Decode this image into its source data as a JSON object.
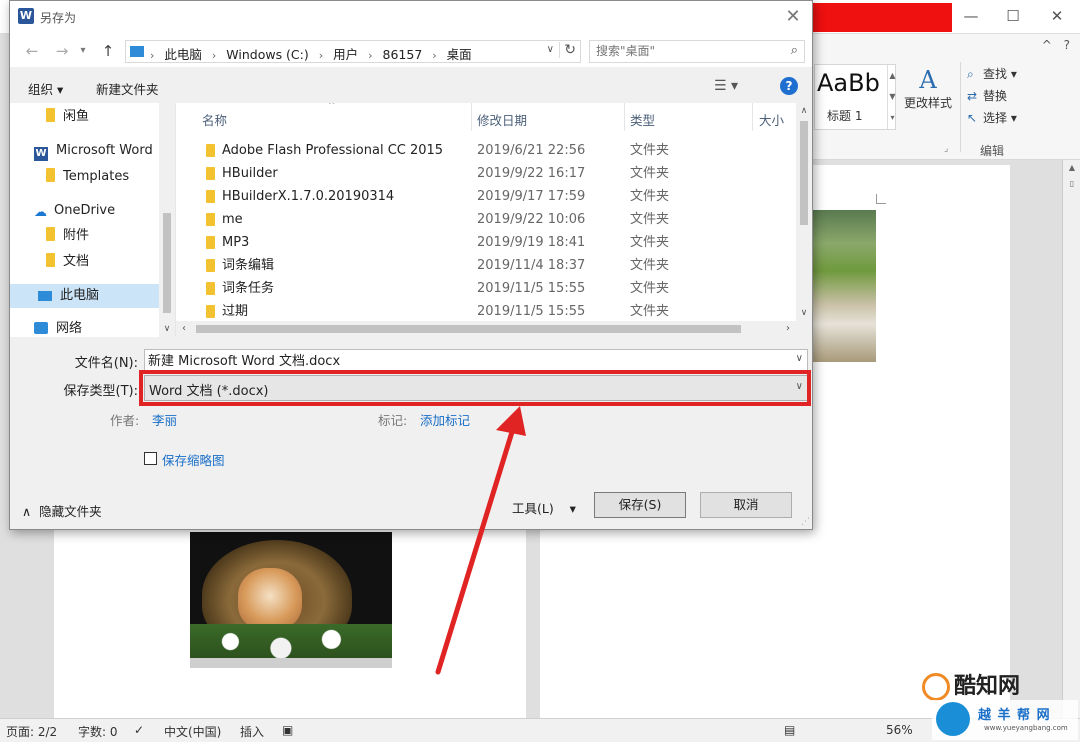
{
  "dialog": {
    "title": "另存为",
    "address": [
      "此电脑",
      "Windows (C:)",
      "用户",
      "86157",
      "桌面"
    ],
    "search_placeholder": "搜索\"桌面\"",
    "toolbar": {
      "organize": "组织 ▾",
      "new_folder": "新建文件夹"
    },
    "nav_items": [
      {
        "label": "闲鱼",
        "icon": "folder-icon"
      },
      {
        "label": "Microsoft Word",
        "icon": "word-icon"
      },
      {
        "label": "Templates",
        "icon": "folder-icon"
      },
      {
        "label": "OneDrive",
        "icon": "cloud-icon"
      },
      {
        "label": "附件",
        "icon": "folder-icon"
      },
      {
        "label": "文档",
        "icon": "folder-icon"
      },
      {
        "label": "此电脑",
        "icon": "pc-icon",
        "selected": true
      },
      {
        "label": "网络",
        "icon": "network-icon"
      }
    ],
    "columns": [
      "名称",
      "修改日期",
      "类型",
      "大小"
    ],
    "files": [
      {
        "name": "Adobe Flash Professional CC 2015",
        "date": "2019/6/21 22:56",
        "type": "文件夹"
      },
      {
        "name": "HBuilder",
        "date": "2019/9/22 16:17",
        "type": "文件夹"
      },
      {
        "name": "HBuilderX.1.7.0.20190314",
        "date": "2019/9/17 17:59",
        "type": "文件夹"
      },
      {
        "name": "me",
        "date": "2019/9/22 10:06",
        "type": "文件夹"
      },
      {
        "name": "MP3",
        "date": "2019/9/19 18:41",
        "type": "文件夹"
      },
      {
        "name": "词条编辑",
        "date": "2019/11/4 18:37",
        "type": "文件夹"
      },
      {
        "name": "词条任务",
        "date": "2019/11/5 15:55",
        "type": "文件夹"
      },
      {
        "name": "过期",
        "date": "2019/11/5 15:55",
        "type": "文件夹"
      }
    ],
    "form": {
      "filename_label": "文件名(N):",
      "filename_value": "新建 Microsoft Word 文档.docx",
      "savetype_label": "保存类型(T):",
      "savetype_value": "Word 文档 (*.docx)",
      "author_label": "作者:",
      "author_value": "李丽",
      "tags_label": "标记:",
      "tags_value": "添加标记",
      "thumbnail_label": "保存缩略图"
    },
    "bottom": {
      "hide_folders": "隐藏文件夹",
      "tools": "工具(L)",
      "save": "保存(S)",
      "cancel": "取消"
    }
  },
  "word": {
    "style_sample": "AaBb",
    "style_name": "标题 1",
    "change_styles": "更改样式",
    "edit_items": [
      "查找",
      "替换",
      "选择"
    ],
    "edit_group": "编辑",
    "status": {
      "page": "页面: 2/2",
      "words": "字数: 0",
      "language": "中文(中国)",
      "insert": "插入",
      "zoom": "56%"
    }
  },
  "watermarks": {
    "top": "酷知网",
    "bottom": "越 羊 帮 网",
    "bottom_url": "www.yueyangbang.com"
  },
  "colors": {
    "highlight": "#e02424",
    "link": "#1a6fc8",
    "selection": "#cce4f7",
    "folder": "#f2c231",
    "word_blue": "#2b579a"
  }
}
